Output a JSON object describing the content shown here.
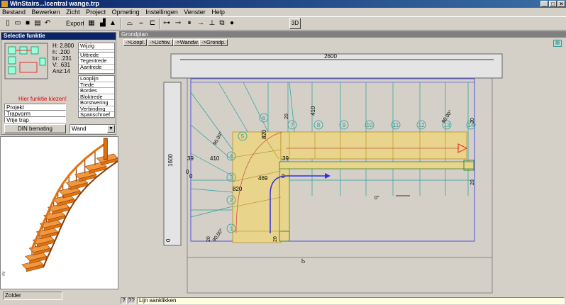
{
  "window": {
    "title": "WinStairs...\\central wange.trp"
  },
  "menu": [
    "Bestand",
    "Bewerken",
    "Zicht",
    "Project",
    "Opmeting",
    "Instellingen",
    "Venster",
    "Help"
  ],
  "toolbar": {
    "export_label": "Export",
    "view3d_label": "3D"
  },
  "selection": {
    "title": "Selectie funktie",
    "params": [
      "H: 2.800",
      "h: .200",
      "br: .231",
      "V: .631",
      "Anz:14"
    ],
    "warning": "Hier funktie kiezen!",
    "list1": [
      "Wijzig",
      "Uittrede",
      "Tegentrede",
      "Aantrede"
    ],
    "list2": [
      "Looplijn",
      "Trede",
      "Bordes",
      "Bloktrede",
      "Borstwering",
      "Verbinding",
      "Spanschroef"
    ],
    "options": [
      "Projekt",
      "Trapvorm",
      "Vrije trap"
    ],
    "din_button": "DIN bemating",
    "type_select": "Wand",
    "colors": {
      "warning": "#e00000"
    }
  },
  "floor": {
    "value": "Zolder"
  },
  "grondplan": {
    "title": "Grondplan",
    "tabs": [
      "->Loopl.",
      "->Lichtw.",
      "->Wandw.",
      "->Grondp."
    ],
    "dims": {
      "top": "2600",
      "left": "1600",
      "d410a": "410",
      "d410b": "410",
      "d820a": "820",
      "d820b": "820",
      "d469": "469",
      "d39a": "39",
      "d39b": "39",
      "d0a": "0",
      "d0b": "0",
      "d0c": "0",
      "d0d": "0",
      "d20a": "20",
      "d20b": "20",
      "d20c": "20",
      "d20d": "20",
      "d20e": "20"
    },
    "angles": {
      "a1": "90,00°",
      "a2": "90,00°",
      "a3": "90,00°",
      "deg1": "0°",
      "deg2": "0°"
    },
    "steps": [
      "1",
      "2",
      "3",
      "4",
      "5",
      "6",
      "7",
      "8",
      "9",
      "10",
      "11",
      "12",
      "13",
      "14"
    ],
    "colors": {
      "tread_fill": "#e8d48a",
      "tread_line": "#b08a20",
      "construction": "#2a9d9d",
      "walkline": "#3030e0",
      "arrow": "#e03030"
    }
  },
  "status": {
    "help1": "?",
    "help2": "??",
    "message": "Lijn aanklikken"
  }
}
